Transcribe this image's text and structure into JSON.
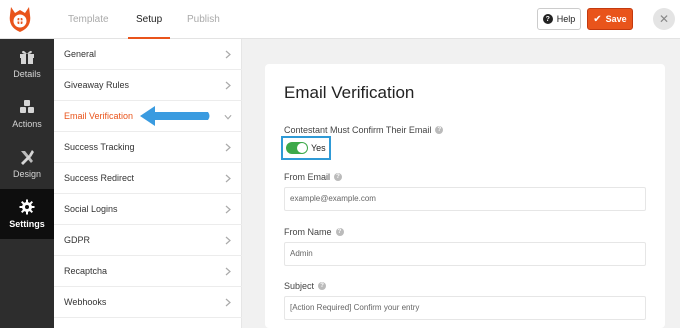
{
  "header": {
    "tabs": [
      {
        "label": "Template",
        "active": false
      },
      {
        "label": "Setup",
        "active": true
      },
      {
        "label": "Publish",
        "active": false
      }
    ],
    "help_label": "Help",
    "save_label": "Save",
    "close_glyph": "✕"
  },
  "leftnav": {
    "items": [
      {
        "label": "Details",
        "icon": "gift-icon",
        "active": false
      },
      {
        "label": "Actions",
        "icon": "actions-icon",
        "active": false
      },
      {
        "label": "Design",
        "icon": "design-icon",
        "active": false
      },
      {
        "label": "Settings",
        "icon": "gear-icon",
        "active": true
      }
    ]
  },
  "submenu": {
    "items": [
      {
        "label": "General",
        "active": false
      },
      {
        "label": "Giveaway Rules",
        "active": false
      },
      {
        "label": "Email Verification",
        "active": true
      },
      {
        "label": "Success Tracking",
        "active": false
      },
      {
        "label": "Success Redirect",
        "active": false
      },
      {
        "label": "Social Logins",
        "active": false
      },
      {
        "label": "GDPR",
        "active": false
      },
      {
        "label": "Recaptcha",
        "active": false
      },
      {
        "label": "Webhooks",
        "active": false
      }
    ]
  },
  "main": {
    "title": "Email Verification",
    "confirm_label": "Contestant Must Confirm Their Email",
    "toggle_label": "Yes",
    "toggle_on": true,
    "from_email_label": "From Email",
    "from_email_value": "example@example.com",
    "from_name_label": "From Name",
    "from_name_value": "Admin",
    "subject_label": "Subject",
    "subject_value": "[Action Required] Confirm your entry"
  },
  "colors": {
    "accent": "#e9541b",
    "highlight": "#2f9ad6",
    "toggle_on": "#3da94a",
    "nav_bg": "#2d2d2d"
  }
}
